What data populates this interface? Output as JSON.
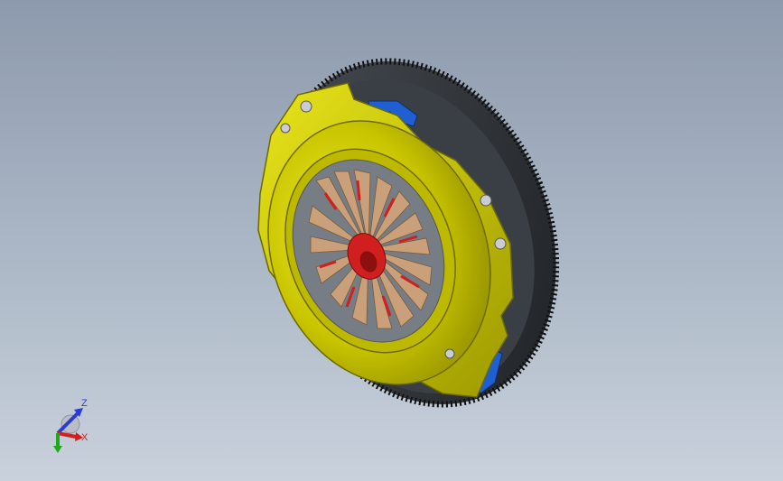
{
  "viewport": {
    "background_top": "#8d9aad",
    "background_bottom": "#c9d1dc"
  },
  "model": {
    "pressure_plate_color": "#c8c400",
    "flywheel_ring_color": "#2b2f33",
    "diaphragm_color": "#caa07a",
    "hub_color": "#d11e1e",
    "lever_color": "#1f5fd1"
  },
  "triad": {
    "z_label": "Z",
    "x_label": "X",
    "z_color": "#2a3cd8",
    "x_color": "#d21e1e",
    "y_color": "#1ea81e"
  }
}
